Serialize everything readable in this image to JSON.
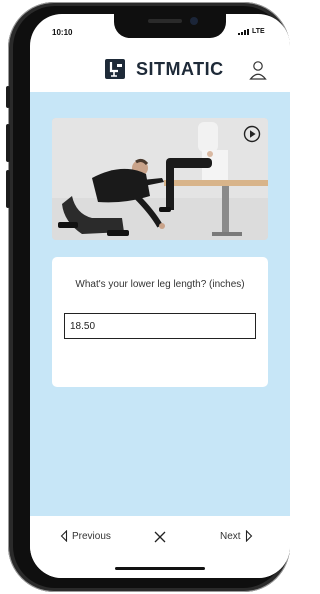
{
  "status": {
    "time": "10:10",
    "network": "LTE"
  },
  "header": {
    "brand": "SITMATIC",
    "logo_icon": "sitmatic-chair-logo",
    "user_icon": "user-icon"
  },
  "video": {
    "play_icon": "play-circle-icon"
  },
  "question": {
    "text": "What's your lower leg length? (inches)",
    "value": "18.50"
  },
  "nav": {
    "previous_label": "Previous",
    "next_label": "Next",
    "close_icon": "close-icon"
  },
  "colors": {
    "content_bg": "#c7e6f7",
    "logo_red": "#e3342f",
    "brand_text": "#1e2a38"
  }
}
